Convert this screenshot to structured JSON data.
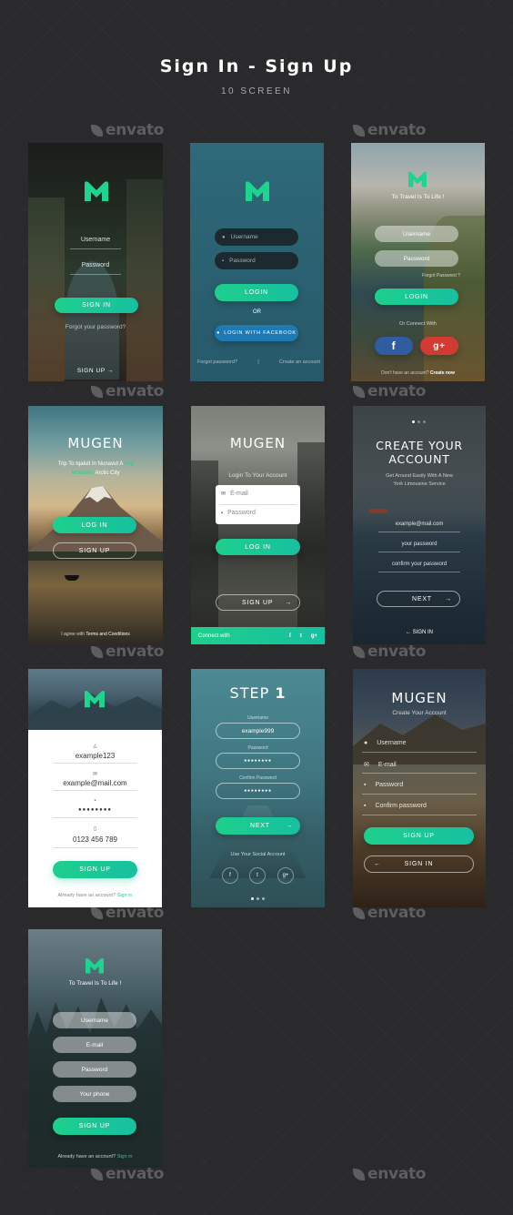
{
  "header": {
    "title": "Sign In - Sign Up",
    "subtitle": "10 SCREEN"
  },
  "watermark": "envato",
  "colors": {
    "accent": "#1ecf8c",
    "background": "#2a2a2c"
  },
  "s1": {
    "username": "Username",
    "password": "Password",
    "signin": "SIGN IN",
    "forgot": "Forgot your password?",
    "signup": "SIGN UP",
    "arrow": "→"
  },
  "s2": {
    "username": "Username",
    "password": "Password",
    "login": "LOGIN",
    "or": "OR",
    "facebook": "LOGIN WITH FACEBOOK",
    "forgot": "Forgot password?",
    "sep": "|",
    "create": "Create an account"
  },
  "s3": {
    "tagline": "To Travel Is To Life !",
    "username": "Username",
    "password": "Password",
    "forgot": "Forgot Password ?",
    "login": "LOGIN",
    "connect": "Or Connect With",
    "fb": "f",
    "gplus": "g+",
    "noacc": "Don't have an account?",
    "create": "Create now"
  },
  "s4": {
    "title": "MUGEN",
    "desc1": "Trip To Iqaluit In Nunavut A",
    "desc_hl": "Fuji Mountain",
    "desc2": "Arctic City",
    "login": "LOG IN",
    "signup": "SIGN UP",
    "agree": "I agree with",
    "terms": "Terms and Conditions"
  },
  "s5": {
    "title": "MUGEN",
    "sub": "Login To Your Account",
    "email": "E-mail",
    "password": "Password",
    "login": "LOG IN",
    "signup": "SIGN UP",
    "arrow": "→",
    "connect": "Connect with",
    "fb": "f",
    "tw": "t",
    "gp": "g+"
  },
  "s6": {
    "title1": "CREATE YOUR",
    "title2": "ACCOUNT",
    "desc1": "Get Around Easily With A New",
    "desc2": "York Limousine Service",
    "email": "example@mail.com",
    "password": "your password",
    "confirm": "confirm your password",
    "next": "NEXT",
    "arrow": "→",
    "signin": "SIGN IN",
    "back": "←"
  },
  "s7": {
    "username": "example123",
    "email": "example@mail.com",
    "password": "●●●●●●●●",
    "phone": "0123 456 789",
    "signup": "SIGN UP",
    "have": "Already have an account?",
    "signin": "Sign in"
  },
  "s8": {
    "step": "STEP",
    "num": "1",
    "ulabel": "Username",
    "uval": "example999",
    "plabel": "Password",
    "pval": "●●●●●●●●",
    "clabel": "Confirm Password",
    "cval": "●●●●●●●●",
    "next": "NEXT",
    "arrow": "→",
    "social": "Use Your Social Account",
    "fb": "f",
    "tw": "t",
    "gp": "g+"
  },
  "s9": {
    "title": "MUGEN",
    "sub": "Create Your Account",
    "username": "Username",
    "email": "E-mail",
    "password": "Password",
    "confirm": "Confirm password",
    "signup": "SIGN UP",
    "signin": "SIGN IN",
    "back": "←"
  },
  "s10": {
    "tagline": "To Travel Is To Life !",
    "username": "Username",
    "email": "E-mail",
    "password": "Password",
    "phone": "Your phone",
    "signup": "SIGN UP",
    "have": "Already have an account?",
    "signin": "Sign in"
  }
}
